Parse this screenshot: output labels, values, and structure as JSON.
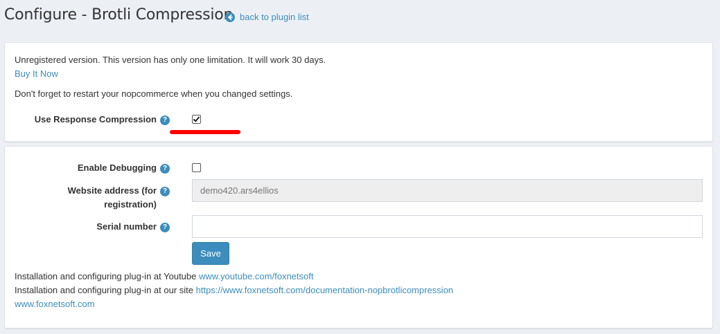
{
  "header": {
    "title": "Configure - Brotli Compression",
    "back_label": "back to plugin list",
    "back_icon": "circle-arrow-left-icon"
  },
  "license_panel": {
    "unregistered_text": "Unregistered version. This version has only one limitation. It will work 30 days.",
    "buy_label": "Buy It Now",
    "restart_text": "Don't forget to restart your nopcommerce when you changed settings.",
    "use_compression_label": "Use Response Compression",
    "use_compression_checked": true
  },
  "settings_panel": {
    "debug_label": "Enable Debugging",
    "debug_checked": false,
    "website_label_line1": "Website address (for",
    "website_label_line2": "registration)",
    "website_value": "demo420.ars4ellios",
    "serial_label": "Serial number",
    "serial_value": "",
    "save_label": "Save",
    "youtube_text": "Installation and configuring plug-in at Youtube",
    "youtube_link": "www.youtube.com/foxnetsoft",
    "site_text": "Installation and configuring plug-in at our site",
    "site_link": "https://www.foxnetsoft.com/documentation-nopbrotlicompression",
    "home_link": "www.foxnetsoft.com"
  },
  "help_glyph": "?",
  "colors": {
    "accent": "#3c8dbc",
    "background": "#ecf0f5",
    "highlight": "#ff0000"
  }
}
